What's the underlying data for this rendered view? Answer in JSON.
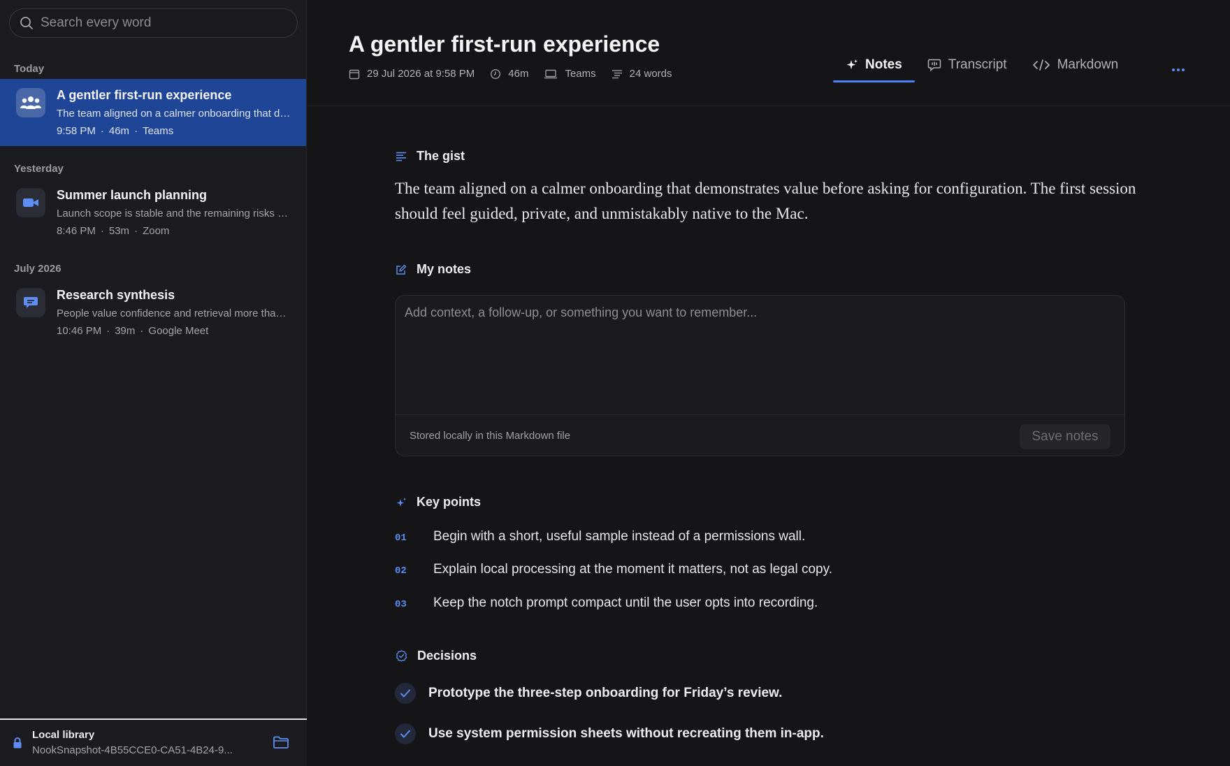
{
  "search": {
    "placeholder": "Search every word"
  },
  "sidebar": {
    "groups": [
      {
        "label": "Today",
        "items": [
          {
            "title": "A gentler first-run experience",
            "summary": "The team aligned on a calmer onboarding that demonstrates value before asking for configuration.",
            "time": "9:58 PM",
            "duration": "46m",
            "platform": "Teams",
            "icon": "people-icon",
            "selected": true
          }
        ]
      },
      {
        "label": "Yesterday",
        "items": [
          {
            "title": "Summer launch planning",
            "summary": "Launch scope is stable and the remaining risks are owned.",
            "time": "8:46 PM",
            "duration": "53m",
            "platform": "Zoom",
            "icon": "video-camera-icon",
            "selected": false
          }
        ]
      },
      {
        "label": "July 2026",
        "items": [
          {
            "title": "Research synthesis",
            "summary": "People value confidence and retrieval more than anything else.",
            "time": "10:46 PM",
            "duration": "39m",
            "platform": "Google Meet",
            "icon": "chat-bubble-icon",
            "selected": false
          }
        ]
      }
    ],
    "footer": {
      "title": "Local library",
      "path": "NookSnapshot-4B55CCE0-CA51-4B24-9..."
    }
  },
  "header": {
    "title": "A gentler first-run experience",
    "date": "29 Jul 2026 at 9:58 PM",
    "duration": "46m",
    "platform": "Teams",
    "word_count": "24 words",
    "tabs": [
      {
        "label": "Notes",
        "icon": "sparkle-icon",
        "active": true
      },
      {
        "label": "Transcript",
        "icon": "speech-bubble-icon",
        "active": false
      },
      {
        "label": "Markdown",
        "icon": "code-icon",
        "active": false
      }
    ]
  },
  "gist": {
    "heading": "The gist",
    "text": "The team aligned on a calmer onboarding that demonstrates value before asking for configuration. The first session should feel guided, private, and unmistakably native to the Mac."
  },
  "my_notes": {
    "heading": "My notes",
    "placeholder": "Add context, a follow-up, or something you want to remember...",
    "stored_label": "Stored locally in this Markdown file",
    "save_label": "Save notes"
  },
  "key_points": {
    "heading": "Key points",
    "items": [
      {
        "num": "01",
        "text": "Begin with a short, useful sample instead of a permissions wall."
      },
      {
        "num": "02",
        "text": "Explain local processing at the moment it matters, not as legal copy."
      },
      {
        "num": "03",
        "text": "Keep the notch prompt compact until the user opts into recording."
      }
    ]
  },
  "decisions": {
    "heading": "Decisions",
    "items": [
      {
        "text": "Prototype the three-step onboarding for Friday’s review."
      },
      {
        "text": "Use system permission sheets without recreating them in-app."
      }
    ]
  },
  "colors": {
    "accent": "#4f7ff0",
    "selected_bg": "#1f4597",
    "background": "#151518",
    "sidebar_bg": "#1c1c20"
  }
}
